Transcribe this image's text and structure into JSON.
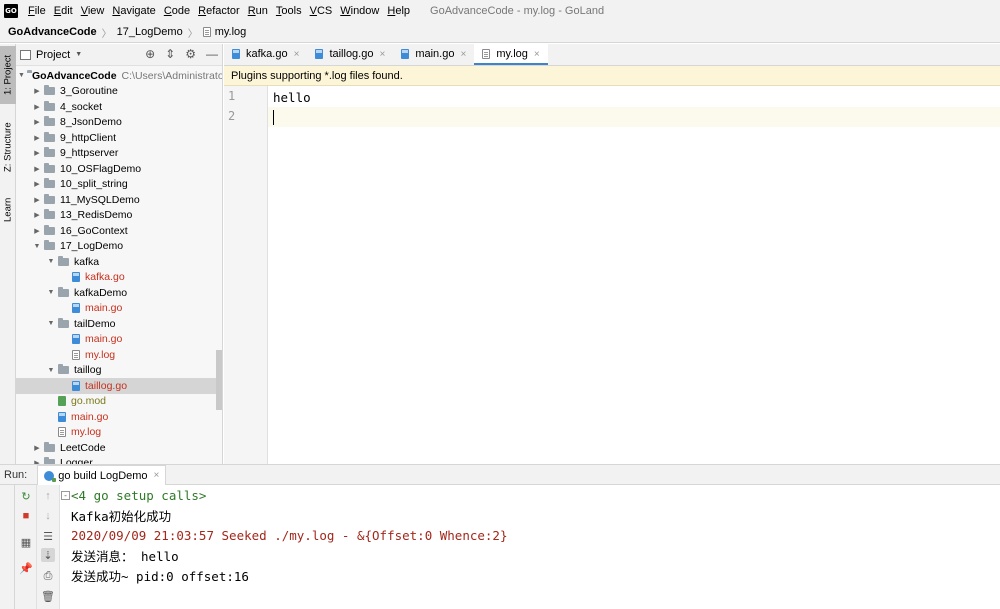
{
  "app": {
    "logo": "GO",
    "window_title": "GoAdvanceCode - my.log - GoLand"
  },
  "menu": [
    {
      "mn": "F",
      "rest": "ile"
    },
    {
      "mn": "E",
      "rest": "dit"
    },
    {
      "mn": "V",
      "rest": "iew"
    },
    {
      "mn": "N",
      "rest": "avigate"
    },
    {
      "mn": "C",
      "rest": "ode"
    },
    {
      "mn": "R",
      "rest": "efactor"
    },
    {
      "mn": "R",
      "rest": "un"
    },
    {
      "mn": "T",
      "rest": "ools"
    },
    {
      "mn": "V",
      "rest": "CS"
    },
    {
      "mn": "W",
      "rest": "indow"
    },
    {
      "mn": "H",
      "rest": "elp"
    }
  ],
  "breadcrumb": [
    "GoAdvanceCode",
    "17_LogDemo",
    "my.log"
  ],
  "left_stripe": {
    "project": "1: Project",
    "structure": "Z: Structure",
    "learn": "Learn"
  },
  "project_panel": {
    "title": "Project",
    "root": {
      "label": "GoAdvanceCode",
      "path": "C:\\Users\\Administrator\\go\\src\\GoAdvanceCode"
    }
  },
  "tree": [
    {
      "label": "3_Goroutine",
      "type": "folder",
      "depth": 1,
      "arrow": "▶"
    },
    {
      "label": "4_socket",
      "type": "folder",
      "depth": 1,
      "arrow": "▶"
    },
    {
      "label": "8_JsonDemo",
      "type": "folder",
      "depth": 1,
      "arrow": "▶"
    },
    {
      "label": "9_httpClient",
      "type": "folder",
      "depth": 1,
      "arrow": "▶"
    },
    {
      "label": "9_httpserver",
      "type": "folder",
      "depth": 1,
      "arrow": "▶"
    },
    {
      "label": "10_OSFlagDemo",
      "type": "folder",
      "depth": 1,
      "arrow": "▶"
    },
    {
      "label": "10_split_string",
      "type": "folder",
      "depth": 1,
      "arrow": "▶"
    },
    {
      "label": "11_MySQLDemo",
      "type": "folder",
      "depth": 1,
      "arrow": "▶"
    },
    {
      "label": "13_RedisDemo",
      "type": "folder",
      "depth": 1,
      "arrow": "▶"
    },
    {
      "label": "16_GoContext",
      "type": "folder",
      "depth": 1,
      "arrow": "▶"
    },
    {
      "label": "17_LogDemo",
      "type": "folder",
      "depth": 1,
      "arrow": "▼"
    },
    {
      "label": "kafka",
      "type": "folder",
      "depth": 2,
      "arrow": "▼"
    },
    {
      "label": "kafka.go",
      "type": "go",
      "depth": 3,
      "color": "red"
    },
    {
      "label": "kafkaDemo",
      "type": "folder",
      "depth": 2,
      "arrow": "▼"
    },
    {
      "label": "main.go",
      "type": "go",
      "depth": 3,
      "color": "red"
    },
    {
      "label": "tailDemo",
      "type": "folder",
      "depth": 2,
      "arrow": "▼"
    },
    {
      "label": "main.go",
      "type": "go",
      "depth": 3,
      "color": "red"
    },
    {
      "label": "my.log",
      "type": "log",
      "depth": 3,
      "color": "red"
    },
    {
      "label": "taillog",
      "type": "folder",
      "depth": 2,
      "arrow": "▼"
    },
    {
      "label": "taillog.go",
      "type": "go",
      "depth": 3,
      "color": "red",
      "selected": true
    },
    {
      "label": "go.mod",
      "type": "mod",
      "depth": 2,
      "color": "olive"
    },
    {
      "label": "main.go",
      "type": "go",
      "depth": 2,
      "color": "red"
    },
    {
      "label": "my.log",
      "type": "log",
      "depth": 2,
      "color": "red"
    },
    {
      "label": "LeetCode",
      "type": "folder",
      "depth": 1,
      "arrow": "▶"
    },
    {
      "label": "Logger",
      "type": "folder",
      "depth": 1,
      "arrow": "▶"
    }
  ],
  "tabs": [
    {
      "label": "kafka.go",
      "type": "go",
      "active": false
    },
    {
      "label": "taillog.go",
      "type": "go",
      "active": false
    },
    {
      "label": "main.go",
      "type": "go",
      "active": false
    },
    {
      "label": "my.log",
      "type": "log",
      "active": true
    }
  ],
  "notification": "Plugins supporting *.log files found.",
  "editor": {
    "lines": [
      {
        "num": "1",
        "text": "hello"
      },
      {
        "num": "2",
        "text": ""
      }
    ]
  },
  "run_panel": {
    "label": "Run:",
    "tab_label": "go build LogDemo",
    "console": [
      {
        "text": "<4 go setup calls>",
        "kind": "fold"
      },
      {
        "text": "Kafka初始化成功",
        "kind": "normal"
      },
      {
        "text": "2020/09/09 21:03:57 Seeked ./my.log - &{Offset:0 Whence:2}",
        "kind": "err"
      },
      {
        "text": "发送消息：  hello",
        "kind": "normal"
      },
      {
        "text": "发送成功~  pid:0 offset:16",
        "kind": "normal"
      }
    ]
  },
  "icons": {
    "close": "×",
    "fold_toggle": "-",
    "crumb_separator": "〉"
  },
  "colors": {
    "accent": "#4083c9",
    "notification_bg": "#fdf5d8",
    "error_text": "#a3271b",
    "fold_text": "#2f7a28",
    "modified_file": "#c7301d"
  }
}
